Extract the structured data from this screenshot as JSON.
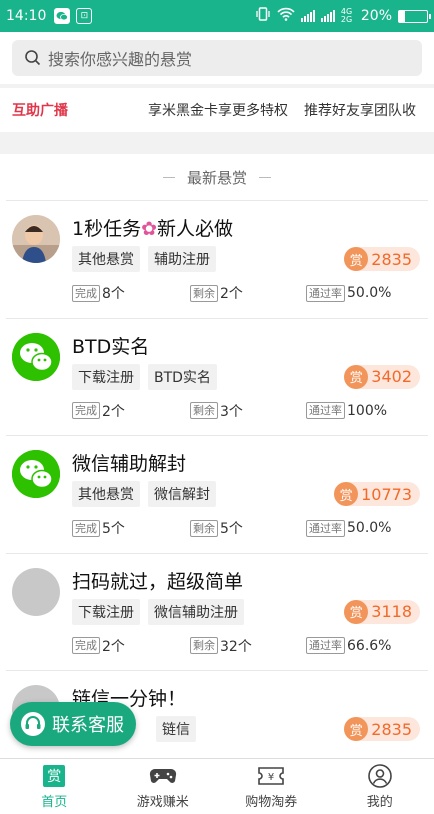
{
  "status_bar": {
    "time": "14:10",
    "net": "4G 2G",
    "battery": "20%",
    "battery_level": 0.2
  },
  "search": {
    "placeholder": "搜索你感兴趣的悬赏"
  },
  "broadcast": {
    "label": "互助广播",
    "items": [
      "享米黑金卡享更多特权",
      "推荐好友享团队收"
    ]
  },
  "section_title": "最新悬赏",
  "reward_badge": "赏",
  "stat_labels": {
    "done": "完成",
    "remain": "剩余",
    "rate": "通过率"
  },
  "tasks": [
    {
      "title": "1秒任务",
      "title_suffix": "新人必做",
      "tags": [
        "其他悬赏",
        "辅助注册"
      ],
      "reward": "2835",
      "done": "8个",
      "remain": "2个",
      "rate": "50.0%",
      "avatar": "photo"
    },
    {
      "title": "BTD实名",
      "title_suffix": "",
      "tags": [
        "下载注册",
        "BTD实名"
      ],
      "reward": "3402",
      "done": "2个",
      "remain": "3个",
      "rate": "100%",
      "avatar": "wechat-icon"
    },
    {
      "title": "微信辅助解封",
      "title_suffix": "",
      "tags": [
        "其他悬赏",
        "微信解封"
      ],
      "reward": "10773",
      "done": "5个",
      "remain": "5个",
      "rate": "50.0%",
      "avatar": "wechat-icon"
    },
    {
      "title": "扫码就过，超级简单",
      "title_suffix": "",
      "tags": [
        "下载注册",
        "微信辅助注册"
      ],
      "reward": "3118",
      "done": "2个",
      "remain": "32个",
      "rate": "66.6%",
      "avatar": "placeholder"
    },
    {
      "title": "链信一分钟！",
      "title_suffix": "",
      "tags": [
        "链信"
      ],
      "reward": "2835",
      "done": "",
      "remain": "",
      "rate": "",
      "avatar": "placeholder"
    }
  ],
  "float_button": {
    "label": "联系客服"
  },
  "bottom_nav": [
    {
      "label": "首页",
      "icon": "home-icon",
      "active": true,
      "glyph": "赏"
    },
    {
      "label": "游戏赚米",
      "icon": "gamepad-icon",
      "active": false
    },
    {
      "label": "购物淘券",
      "icon": "ticket-icon",
      "active": false,
      "glyph": "¥"
    },
    {
      "label": "我的",
      "icon": "user-icon",
      "active": false
    }
  ],
  "colors": {
    "primary": "#19b48c",
    "broadcast_label": "#e0364a",
    "reward": "#f26a2a"
  }
}
